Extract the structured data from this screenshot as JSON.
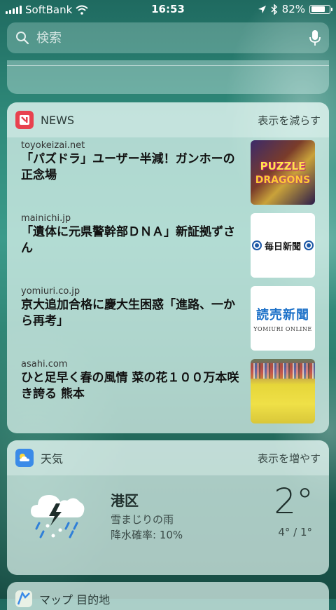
{
  "status_bar": {
    "carrier": "SoftBank",
    "time": "16:53",
    "battery_percent": "82%",
    "battery_level": 0.82
  },
  "search": {
    "placeholder": "検索"
  },
  "news_widget": {
    "title": "NEWS",
    "action": "表示を減らす",
    "items": [
      {
        "source": "toyokeizai.net",
        "headline": "「パズドラ」ユーザー半減！ガンホーの正念場",
        "thumb_text_1": "PUZZLE",
        "thumb_text_2": "DRAGONS"
      },
      {
        "source": "mainichi.jp",
        "headline": "「遺体に元県警幹部ＤＮＡ」新証拠ずさん",
        "thumb_text": "毎日新聞"
      },
      {
        "source": "yomiuri.co.jp",
        "headline": "京大追加合格に慶大生困惑「進路、一から再考」",
        "thumb_text_1": "読売新聞",
        "thumb_text_2": "YOMIURI ONLINE"
      },
      {
        "source": "asahi.com",
        "headline": "ひと足早く春の風情 菜の花１００万本咲き誇る 熊本"
      }
    ]
  },
  "weather_widget": {
    "title": "天気",
    "action": "表示を増やす",
    "location": "港区",
    "condition": "雪まじりの雨",
    "precipitation": "降水確率: 10%",
    "temperature": "2°",
    "range": "4° / 1°"
  },
  "maps_widget": {
    "title": "マップ 目的地"
  },
  "colors": {
    "news_icon_red": "#e8424f",
    "weather_icon_blue": "#3b8be8",
    "rain_blue": "#2f7fd8"
  }
}
